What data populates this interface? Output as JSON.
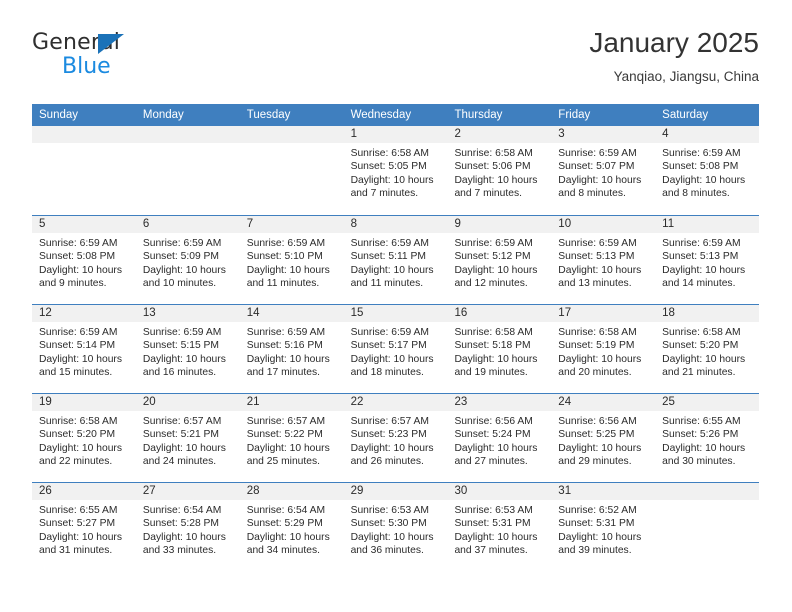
{
  "brand": {
    "name_top": "General",
    "name_bottom": "Blue",
    "accent_dark_blue": "#1b72b8",
    "accent_light_blue": "#1b8ae0"
  },
  "header": {
    "title": "January 2025",
    "subtitle": "Yanqiao, Jiangsu, China"
  },
  "calendar": {
    "header_bg": "#3f7fbf",
    "daynum_bg": "#f1f1f1",
    "weekdays": [
      "Sunday",
      "Monday",
      "Tuesday",
      "Wednesday",
      "Thursday",
      "Friday",
      "Saturday"
    ],
    "weeks": [
      [
        {
          "day": "",
          "sunrise": "",
          "sunset": "",
          "daylight1": "",
          "daylight2": "",
          "empty": true
        },
        {
          "day": "",
          "sunrise": "",
          "sunset": "",
          "daylight1": "",
          "daylight2": "",
          "empty": true
        },
        {
          "day": "",
          "sunrise": "",
          "sunset": "",
          "daylight1": "",
          "daylight2": "",
          "empty": true
        },
        {
          "day": "1",
          "sunrise": "Sunrise: 6:58 AM",
          "sunset": "Sunset: 5:05 PM",
          "daylight1": "Daylight: 10 hours",
          "daylight2": "and 7 minutes."
        },
        {
          "day": "2",
          "sunrise": "Sunrise: 6:58 AM",
          "sunset": "Sunset: 5:06 PM",
          "daylight1": "Daylight: 10 hours",
          "daylight2": "and 7 minutes."
        },
        {
          "day": "3",
          "sunrise": "Sunrise: 6:59 AM",
          "sunset": "Sunset: 5:07 PM",
          "daylight1": "Daylight: 10 hours",
          "daylight2": "and 8 minutes."
        },
        {
          "day": "4",
          "sunrise": "Sunrise: 6:59 AM",
          "sunset": "Sunset: 5:08 PM",
          "daylight1": "Daylight: 10 hours",
          "daylight2": "and 8 minutes."
        }
      ],
      [
        {
          "day": "5",
          "sunrise": "Sunrise: 6:59 AM",
          "sunset": "Sunset: 5:08 PM",
          "daylight1": "Daylight: 10 hours",
          "daylight2": "and 9 minutes."
        },
        {
          "day": "6",
          "sunrise": "Sunrise: 6:59 AM",
          "sunset": "Sunset: 5:09 PM",
          "daylight1": "Daylight: 10 hours",
          "daylight2": "and 10 minutes."
        },
        {
          "day": "7",
          "sunrise": "Sunrise: 6:59 AM",
          "sunset": "Sunset: 5:10 PM",
          "daylight1": "Daylight: 10 hours",
          "daylight2": "and 11 minutes."
        },
        {
          "day": "8",
          "sunrise": "Sunrise: 6:59 AM",
          "sunset": "Sunset: 5:11 PM",
          "daylight1": "Daylight: 10 hours",
          "daylight2": "and 11 minutes."
        },
        {
          "day": "9",
          "sunrise": "Sunrise: 6:59 AM",
          "sunset": "Sunset: 5:12 PM",
          "daylight1": "Daylight: 10 hours",
          "daylight2": "and 12 minutes."
        },
        {
          "day": "10",
          "sunrise": "Sunrise: 6:59 AM",
          "sunset": "Sunset: 5:13 PM",
          "daylight1": "Daylight: 10 hours",
          "daylight2": "and 13 minutes."
        },
        {
          "day": "11",
          "sunrise": "Sunrise: 6:59 AM",
          "sunset": "Sunset: 5:13 PM",
          "daylight1": "Daylight: 10 hours",
          "daylight2": "and 14 minutes."
        }
      ],
      [
        {
          "day": "12",
          "sunrise": "Sunrise: 6:59 AM",
          "sunset": "Sunset: 5:14 PM",
          "daylight1": "Daylight: 10 hours",
          "daylight2": "and 15 minutes."
        },
        {
          "day": "13",
          "sunrise": "Sunrise: 6:59 AM",
          "sunset": "Sunset: 5:15 PM",
          "daylight1": "Daylight: 10 hours",
          "daylight2": "and 16 minutes."
        },
        {
          "day": "14",
          "sunrise": "Sunrise: 6:59 AM",
          "sunset": "Sunset: 5:16 PM",
          "daylight1": "Daylight: 10 hours",
          "daylight2": "and 17 minutes."
        },
        {
          "day": "15",
          "sunrise": "Sunrise: 6:59 AM",
          "sunset": "Sunset: 5:17 PM",
          "daylight1": "Daylight: 10 hours",
          "daylight2": "and 18 minutes."
        },
        {
          "day": "16",
          "sunrise": "Sunrise: 6:58 AM",
          "sunset": "Sunset: 5:18 PM",
          "daylight1": "Daylight: 10 hours",
          "daylight2": "and 19 minutes."
        },
        {
          "day": "17",
          "sunrise": "Sunrise: 6:58 AM",
          "sunset": "Sunset: 5:19 PM",
          "daylight1": "Daylight: 10 hours",
          "daylight2": "and 20 minutes."
        },
        {
          "day": "18",
          "sunrise": "Sunrise: 6:58 AM",
          "sunset": "Sunset: 5:20 PM",
          "daylight1": "Daylight: 10 hours",
          "daylight2": "and 21 minutes."
        }
      ],
      [
        {
          "day": "19",
          "sunrise": "Sunrise: 6:58 AM",
          "sunset": "Sunset: 5:20 PM",
          "daylight1": "Daylight: 10 hours",
          "daylight2": "and 22 minutes."
        },
        {
          "day": "20",
          "sunrise": "Sunrise: 6:57 AM",
          "sunset": "Sunset: 5:21 PM",
          "daylight1": "Daylight: 10 hours",
          "daylight2": "and 24 minutes."
        },
        {
          "day": "21",
          "sunrise": "Sunrise: 6:57 AM",
          "sunset": "Sunset: 5:22 PM",
          "daylight1": "Daylight: 10 hours",
          "daylight2": "and 25 minutes."
        },
        {
          "day": "22",
          "sunrise": "Sunrise: 6:57 AM",
          "sunset": "Sunset: 5:23 PM",
          "daylight1": "Daylight: 10 hours",
          "daylight2": "and 26 minutes."
        },
        {
          "day": "23",
          "sunrise": "Sunrise: 6:56 AM",
          "sunset": "Sunset: 5:24 PM",
          "daylight1": "Daylight: 10 hours",
          "daylight2": "and 27 minutes."
        },
        {
          "day": "24",
          "sunrise": "Sunrise: 6:56 AM",
          "sunset": "Sunset: 5:25 PM",
          "daylight1": "Daylight: 10 hours",
          "daylight2": "and 29 minutes."
        },
        {
          "day": "25",
          "sunrise": "Sunrise: 6:55 AM",
          "sunset": "Sunset: 5:26 PM",
          "daylight1": "Daylight: 10 hours",
          "daylight2": "and 30 minutes."
        }
      ],
      [
        {
          "day": "26",
          "sunrise": "Sunrise: 6:55 AM",
          "sunset": "Sunset: 5:27 PM",
          "daylight1": "Daylight: 10 hours",
          "daylight2": "and 31 minutes."
        },
        {
          "day": "27",
          "sunrise": "Sunrise: 6:54 AM",
          "sunset": "Sunset: 5:28 PM",
          "daylight1": "Daylight: 10 hours",
          "daylight2": "and 33 minutes."
        },
        {
          "day": "28",
          "sunrise": "Sunrise: 6:54 AM",
          "sunset": "Sunset: 5:29 PM",
          "daylight1": "Daylight: 10 hours",
          "daylight2": "and 34 minutes."
        },
        {
          "day": "29",
          "sunrise": "Sunrise: 6:53 AM",
          "sunset": "Sunset: 5:30 PM",
          "daylight1": "Daylight: 10 hours",
          "daylight2": "and 36 minutes."
        },
        {
          "day": "30",
          "sunrise": "Sunrise: 6:53 AM",
          "sunset": "Sunset: 5:31 PM",
          "daylight1": "Daylight: 10 hours",
          "daylight2": "and 37 minutes."
        },
        {
          "day": "31",
          "sunrise": "Sunrise: 6:52 AM",
          "sunset": "Sunset: 5:31 PM",
          "daylight1": "Daylight: 10 hours",
          "daylight2": "and 39 minutes."
        },
        {
          "day": "",
          "sunrise": "",
          "sunset": "",
          "daylight1": "",
          "daylight2": "",
          "empty": true
        }
      ]
    ]
  }
}
